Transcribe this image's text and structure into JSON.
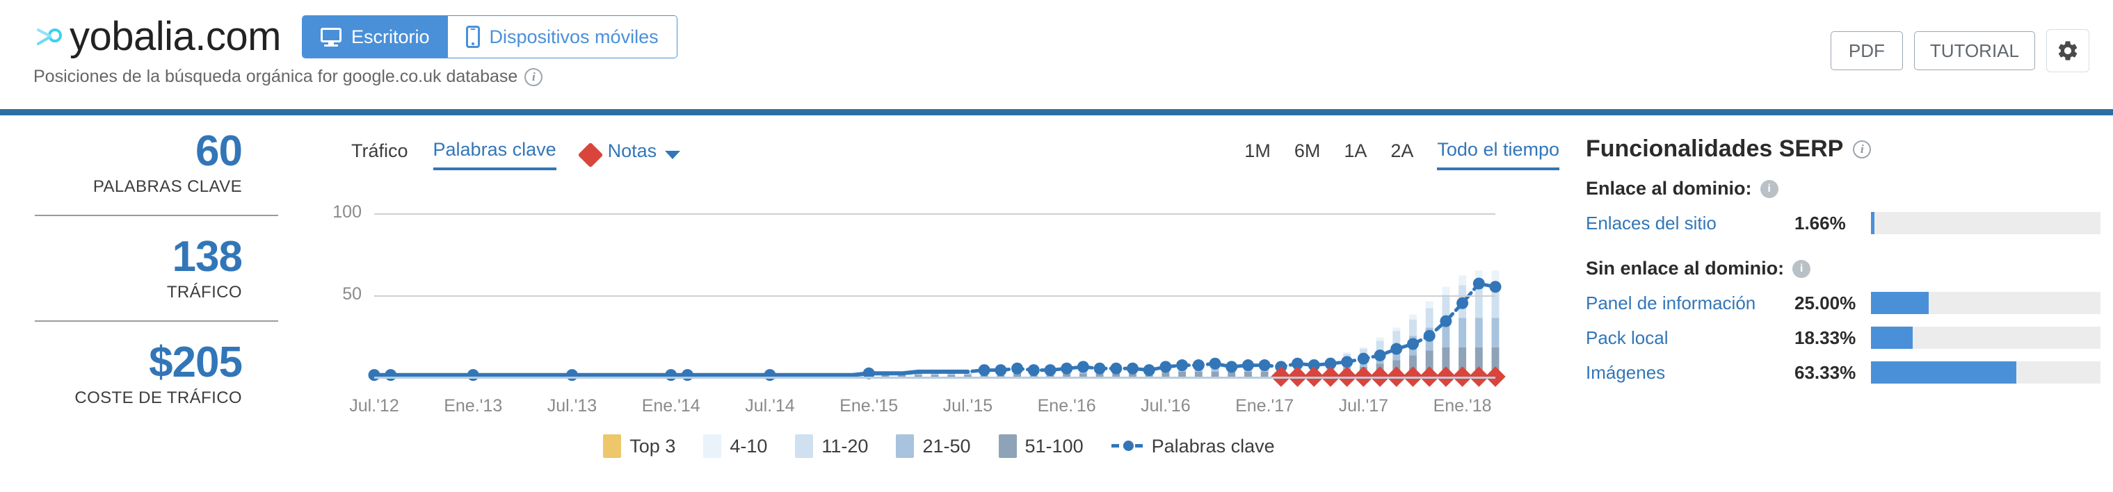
{
  "header": {
    "domain": "yobalia.com",
    "logo_icon": "yobalia-logo-icon",
    "subtitle": "Posiciones de la búsqueda orgánica for google.co.uk database",
    "subtitle_info": "i",
    "device_tabs": [
      {
        "label": "Escritorio",
        "icon": "monitor-icon",
        "active": true
      },
      {
        "label": "Dispositivos móviles",
        "icon": "mobile-phone-icon",
        "active": false
      }
    ],
    "actions": {
      "pdf": "PDF",
      "tutorial": "TUTORIAL",
      "settings_icon": "gear-icon"
    }
  },
  "stats": [
    {
      "value": "60",
      "label": "PALABRAS CLAVE"
    },
    {
      "value": "138",
      "label": "TRÁFICO"
    },
    {
      "value": "$205",
      "label": "COSTE DE TRÁFICO"
    }
  ],
  "chart_toolbar": {
    "metrics": [
      {
        "label": "Tráfico",
        "active": false,
        "style": "plain"
      },
      {
        "label": "Palabras clave",
        "active": true,
        "style": "link"
      }
    ],
    "notes": {
      "label": "Notas",
      "marker_icon": "red-diamond-icon",
      "caret_icon": "chevron-down-icon"
    },
    "ranges": [
      {
        "label": "1M",
        "active": false
      },
      {
        "label": "6M",
        "active": false
      },
      {
        "label": "1A",
        "active": false
      },
      {
        "label": "2A",
        "active": false
      },
      {
        "label": "Todo el tiempo",
        "active": true
      }
    ]
  },
  "serp": {
    "title": "Funcionalidades SERP",
    "title_info": "i",
    "groups": [
      {
        "heading": "Enlace al dominio:",
        "info_icon": "info-icon",
        "rows": [
          {
            "name": "Enlaces del sitio",
            "percent": "1.66%",
            "value": 1.66
          }
        ]
      },
      {
        "heading": "Sin enlace al dominio:",
        "info_icon": "info-icon",
        "rows": [
          {
            "name": "Panel de información",
            "percent": "25.00%",
            "value": 25.0
          },
          {
            "name": "Pack local",
            "percent": "18.33%",
            "value": 18.33
          },
          {
            "name": "Imágenes",
            "percent": "63.33%",
            "value": 63.33
          }
        ]
      }
    ]
  },
  "colors": {
    "brand_blue": "#3276b8",
    "accent_blue": "#4a90d9",
    "divider_blue": "#2e6da4",
    "note_red": "#d9453c",
    "top3": "#eec76b",
    "r4_10": "#eaf2fa",
    "r11_20": "#cfe0f0",
    "r21_50": "#a8c3de",
    "r51_100": "#8fa3b8",
    "track_gray": "#ececec"
  },
  "chart_data": {
    "type": "bar",
    "subtype": "stacked-bar-with-line-overlay",
    "title": "Palabras clave",
    "xlabel": "",
    "ylabel": "",
    "ylim": [
      0,
      100
    ],
    "yticks": [
      50,
      100
    ],
    "grid": true,
    "legend_position": "bottom",
    "legend": [
      "Top 3",
      "4-10",
      "11-20",
      "21-50",
      "51-100",
      "Palabras clave"
    ],
    "xtick_labels": [
      "Jul.'12",
      "Ene.'13",
      "Jul.'13",
      "Ene.'14",
      "Jul.'14",
      "Ene.'15",
      "Jul.'15",
      "Ene.'16",
      "Jul.'16",
      "Ene.'17",
      "Jul.'17",
      "Ene.'18"
    ],
    "x": [
      "Jul.'12",
      "Ago.'12",
      "Sep.'12",
      "Oct.'12",
      "Nov.'12",
      "Dic.'12",
      "Ene.'13",
      "Feb.'13",
      "Mar.'13",
      "Abr.'13",
      "May.'13",
      "Jun.'13",
      "Jul.'13",
      "Ago.'13",
      "Sep.'13",
      "Oct.'13",
      "Nov.'13",
      "Dic.'13",
      "Ene.'14",
      "Feb.'14",
      "Mar.'14",
      "Abr.'14",
      "May.'14",
      "Jun.'14",
      "Jul.'14",
      "Ago.'14",
      "Sep.'14",
      "Oct.'14",
      "Nov.'14",
      "Dic.'14",
      "Ene.'15",
      "Feb.'15",
      "Mar.'15",
      "Abr.'15",
      "May.'15",
      "Jun.'15",
      "Jul.'15",
      "Ago.'15",
      "Sep.'15",
      "Oct.'15",
      "Nov.'15",
      "Dic.'15",
      "Ene.'16",
      "Feb.'16",
      "Mar.'16",
      "Abr.'16",
      "May.'16",
      "Jun.'16",
      "Jul.'16",
      "Ago.'16",
      "Sep.'16",
      "Oct.'16",
      "Nov.'16",
      "Dic.'16",
      "Ene.'17",
      "Feb.'17",
      "Mar.'17",
      "Abr.'17",
      "May.'17",
      "Jun.'17",
      "Jul.'17",
      "Ago.'17",
      "Sep.'17",
      "Oct.'17",
      "Nov.'17",
      "Dic.'17",
      "Ene.'18",
      "Feb.'18",
      "Mar.'18"
    ],
    "series": [
      {
        "name": "Top 3",
        "color": "#eec76b",
        "values": [
          0,
          0,
          0,
          0,
          0,
          0,
          0,
          0,
          0,
          0,
          0,
          0,
          0,
          0,
          0,
          0,
          0,
          0,
          0,
          0,
          0,
          0,
          0,
          0,
          0,
          0,
          0,
          0,
          0,
          0,
          0,
          0,
          0,
          0,
          0,
          0,
          0,
          0,
          0,
          0,
          0,
          0,
          0,
          0,
          0,
          0,
          0,
          0,
          0,
          0,
          0,
          0,
          0,
          0,
          0,
          0,
          0,
          0,
          0,
          0,
          0,
          0,
          0,
          0,
          0,
          0,
          0,
          0,
          0
        ]
      },
      {
        "name": "4-10",
        "color": "#eaf2fa",
        "values": [
          0,
          0,
          0,
          0,
          0,
          0,
          0,
          0,
          0,
          0,
          0,
          0,
          0,
          0,
          0,
          0,
          0,
          0,
          0,
          0,
          0,
          0,
          0,
          0,
          0,
          0,
          0,
          0,
          0,
          0,
          0,
          0,
          0,
          0,
          0,
          0,
          0,
          0,
          0,
          0,
          0,
          0,
          0,
          0,
          0,
          0,
          0,
          0,
          0,
          0,
          0,
          0,
          0,
          0,
          0,
          0,
          1,
          1,
          1,
          1,
          1,
          2,
          2,
          3,
          4,
          5,
          6,
          7,
          7
        ]
      },
      {
        "name": "11-20",
        "color": "#cfe0f0",
        "values": [
          0,
          0,
          0,
          0,
          0,
          0,
          0,
          0,
          0,
          0,
          0,
          0,
          0,
          0,
          0,
          0,
          0,
          0,
          0,
          0,
          0,
          0,
          0,
          0,
          0,
          0,
          0,
          0,
          0,
          0,
          0,
          0,
          0,
          0,
          0,
          0,
          0,
          0,
          1,
          1,
          1,
          1,
          1,
          1,
          1,
          1,
          1,
          1,
          1,
          1,
          1,
          2,
          2,
          2,
          2,
          2,
          2,
          3,
          3,
          4,
          5,
          6,
          8,
          10,
          12,
          16,
          20,
          22,
          22
        ]
      },
      {
        "name": "21-50",
        "color": "#a8c3de",
        "values": [
          0,
          0,
          0,
          0,
          0,
          0,
          0,
          0,
          0,
          0,
          0,
          0,
          0,
          0,
          0,
          0,
          0,
          0,
          0,
          0,
          0,
          0,
          0,
          0,
          0,
          0,
          0,
          0,
          0,
          0,
          0,
          0,
          0,
          1,
          1,
          1,
          1,
          1,
          1,
          2,
          2,
          2,
          2,
          2,
          2,
          2,
          2,
          2,
          3,
          3,
          3,
          3,
          3,
          3,
          3,
          3,
          4,
          4,
          4,
          5,
          6,
          8,
          10,
          12,
          14,
          16,
          18,
          18,
          18
        ]
      },
      {
        "name": "51-100",
        "color": "#8fa3b8",
        "values": [
          0,
          0,
          0,
          0,
          0,
          0,
          0,
          0,
          0,
          0,
          0,
          0,
          0,
          0,
          0,
          0,
          0,
          0,
          0,
          0,
          0,
          0,
          0,
          0,
          0,
          0,
          0,
          0,
          0,
          0,
          0,
          1,
          1,
          1,
          1,
          1,
          1,
          2,
          2,
          2,
          2,
          2,
          2,
          2,
          2,
          2,
          2,
          2,
          3,
          3,
          3,
          3,
          3,
          3,
          3,
          3,
          3,
          3,
          4,
          5,
          6,
          8,
          10,
          13,
          16,
          18,
          18,
          18,
          18
        ]
      }
    ],
    "line_series": {
      "name": "Palabras clave",
      "color": "#3276b8",
      "style": "dashed-with-markers",
      "values": [
        1,
        1,
        1,
        1,
        1,
        1,
        1,
        1,
        1,
        1,
        1,
        1,
        1,
        1,
        1,
        1,
        1,
        1,
        1,
        1,
        1,
        1,
        1,
        1,
        1,
        1,
        1,
        1,
        1,
        1,
        2,
        2,
        2,
        3,
        3,
        3,
        3,
        4,
        4,
        5,
        4,
        4,
        5,
        6,
        5,
        5,
        5,
        4,
        6,
        7,
        7,
        8,
        6,
        7,
        7,
        6,
        8,
        7,
        8,
        9,
        11,
        13,
        17,
        20,
        25,
        34,
        45,
        57,
        55
      ]
    },
    "note_markers": {
      "name": "Notas",
      "color": "#d9453c",
      "icon": "red-diamond-icon",
      "from_index": 55,
      "to_index": 68
    }
  }
}
